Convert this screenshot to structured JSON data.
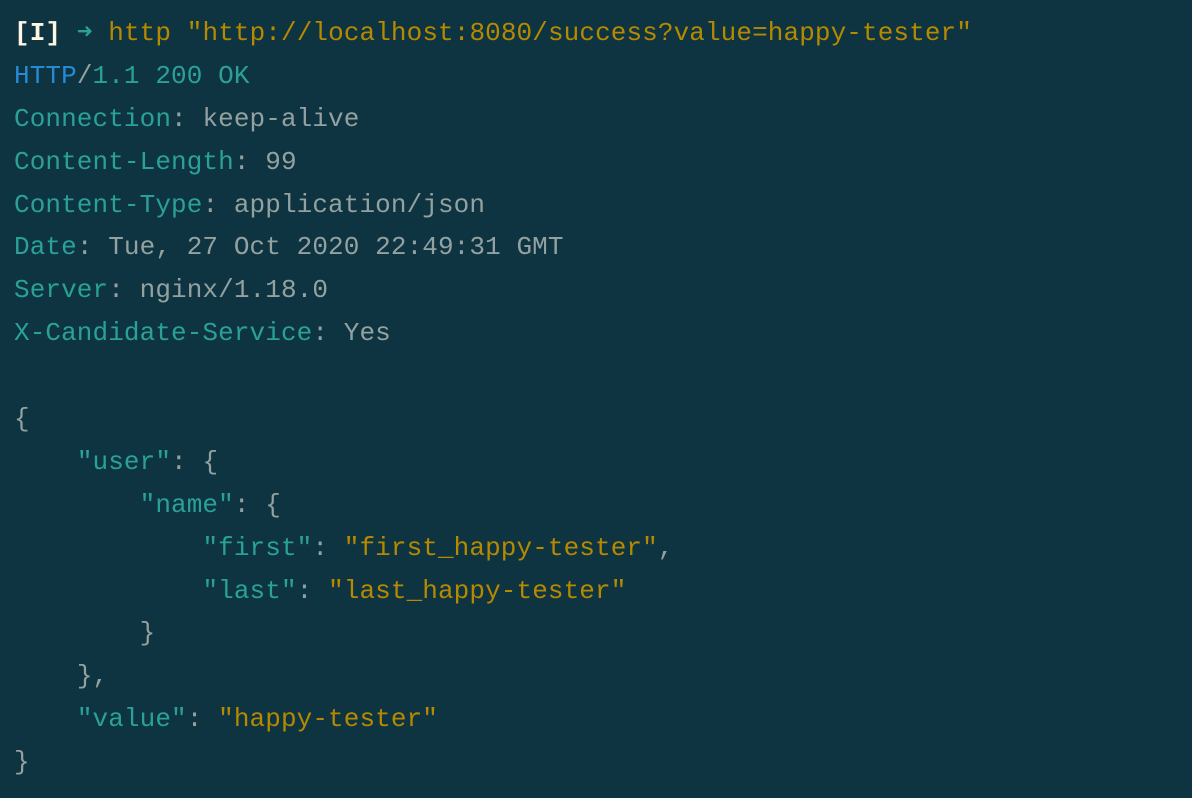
{
  "prompt": {
    "mode": "[I]",
    "arrow": "➜",
    "command": "http",
    "arg": "\"http://localhost:8080/success?value=happy-tester\""
  },
  "status_line": {
    "proto": "HTTP",
    "slash": "/",
    "version": "1.1",
    "code": "200",
    "reason": "OK"
  },
  "headers": {
    "connection": {
      "name": "Connection",
      "value": "keep-alive"
    },
    "content_length": {
      "name": "Content-Length",
      "value": "99"
    },
    "content_type": {
      "name": "Content-Type",
      "value": "application/json"
    },
    "date": {
      "name": "Date",
      "value": "Tue, 27 Oct 2020 22:49:31 GMT"
    },
    "server": {
      "name": "Server",
      "value": "nginx/1.18.0"
    },
    "x_candidate": {
      "name": "X-Candidate-Service",
      "value": "Yes"
    }
  },
  "json": {
    "open": "{",
    "user_key": "\"user\"",
    "name_key": "\"name\"",
    "first_key": "\"first\"",
    "first_val": "\"first_happy-tester\"",
    "last_key": "\"last\"",
    "last_val": "\"last_happy-tester\"",
    "value_key": "\"value\"",
    "value_val": "\"happy-tester\"",
    "close": "}",
    "colon_space": ": ",
    "open_brace": "{",
    "close_brace": "}",
    "comma": ","
  },
  "indent": {
    "one": "    ",
    "two": "        ",
    "three": "            "
  }
}
